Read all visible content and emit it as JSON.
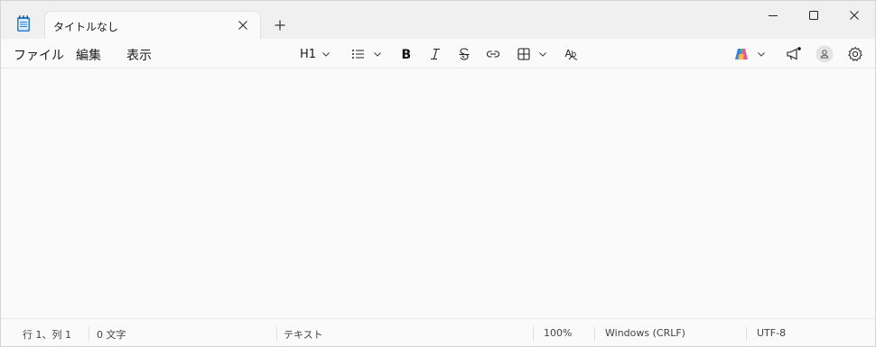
{
  "tab": {
    "title": "タイトルなし"
  },
  "menu": {
    "file": "ファイル",
    "edit": "編集",
    "view": "表示"
  },
  "toolbar": {
    "heading_label": "H1"
  },
  "status": {
    "position": "行 1、列 1",
    "char_count": "0 文字",
    "format": "テキスト",
    "zoom": "100%",
    "line_ending": "Windows (CRLF)",
    "encoding": "UTF-8"
  },
  "colors": {
    "accent": "#0067c0",
    "background": "#fafafa",
    "titlebar": "#f0f0f0"
  }
}
